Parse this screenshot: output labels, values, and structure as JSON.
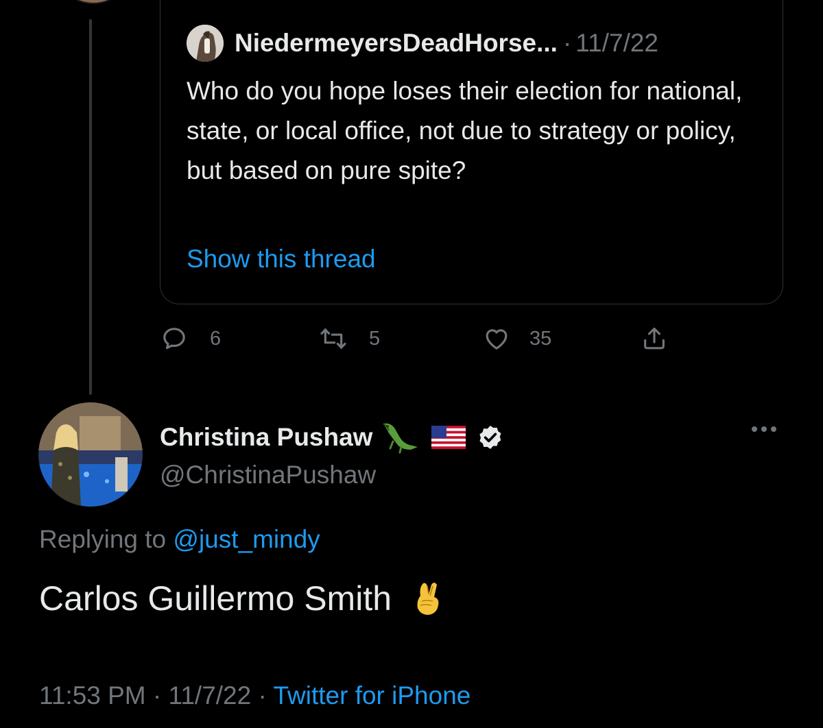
{
  "quoted_tweet": {
    "author_name": "NiedermeyersDeadHorse...",
    "separator": "·",
    "date": "11/7/22",
    "text": "Who do you hope loses their election for national, state, or local office, not due to strategy or policy,  but based on pure spite?",
    "show_thread_label": "Show this thread"
  },
  "actions": {
    "reply_count": "6",
    "retweet_count": "5",
    "like_count": "35"
  },
  "reply_tweet": {
    "author_name": "Christina Pushaw",
    "name_emojis": "🐊 🇺🇸",
    "handle": "@ChristinaPushaw",
    "replying_prefix": "Replying to",
    "replying_to": "@just_mindy",
    "text": "Carlos Guillermo Smith",
    "text_emoji": "🤞",
    "time": "11:53 PM",
    "separator": "·",
    "date": "11/7/22",
    "source": "Twitter for iPhone"
  },
  "colors": {
    "background": "#000000",
    "text_primary": "#e7e9ea",
    "text_secondary": "#71767b",
    "link": "#1d9bf0",
    "border": "#2f3336"
  },
  "icons": [
    "reply-icon",
    "retweet-icon",
    "like-icon",
    "share-icon",
    "verified-badge-icon",
    "more-icon",
    "alligator-emoji-icon",
    "us-flag-emoji-icon",
    "crossed-fingers-emoji-icon"
  ]
}
